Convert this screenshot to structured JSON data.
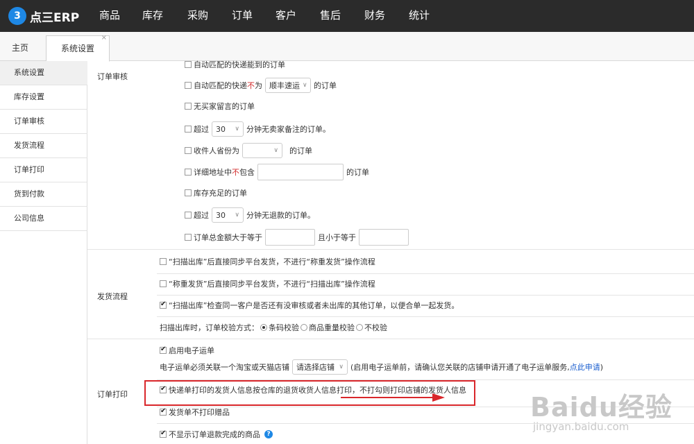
{
  "app": {
    "logo_mark": "3",
    "logo_text": "点三ERP",
    "nav": [
      "商品",
      "库存",
      "采购",
      "订单",
      "客户",
      "售后",
      "财务",
      "统计"
    ]
  },
  "tabs": {
    "home": "主页",
    "settings": "系统设置",
    "close": "×"
  },
  "sidebar": {
    "items": [
      "系统设置",
      "库存设置",
      "订单审核",
      "发货流程",
      "订单打印",
      "货到付款",
      "公司信息"
    ],
    "active": "系统设置"
  },
  "order_review": {
    "label": "订单审核",
    "r1": "自动匹配的快递能到的订单",
    "r2_a": "自动匹配的快递",
    "r2_red": "不",
    "r2_b": "为",
    "r2_select": "顺丰速运",
    "r2_c": "的订单",
    "r3": "无买家留言的订单",
    "r4_a": "超过",
    "r4_select": "30",
    "r4_b": "分钟无卖家备注的订单。",
    "r5_a": "收件人省份为",
    "r5_select": "",
    "r5_b": "的订单",
    "r6_a": "详细地址中",
    "r6_red": "不",
    "r6_b": "包含",
    "r6_c": "的订单",
    "r7": "库存充足的订单",
    "r8_a": "超过",
    "r8_select": "30",
    "r8_b": "分钟无退款的订单。",
    "r9_a": "订单总金额大于等于",
    "r9_b": "且小于等于"
  },
  "shipping": {
    "label": "发货流程",
    "r1": "“扫描出库”后直接同步平台发货，不进行“称重发货”操作流程",
    "r2": "“称重发货”后直接同步平台发货，不进行“扫描出库”操作流程",
    "r3": "“扫描出库”检查同一客户是否还有没审核或者未出库的其他订单，以便合单一起发货。",
    "r4_label": "扫描出库时，订单校验方式：",
    "r4_options": [
      "条码校验",
      "商品重量校验",
      "不校验"
    ],
    "r4_selected": "条码校验"
  },
  "printing": {
    "label": "订单打印",
    "r1": "启用电子运单",
    "r2_a": "电子运单必须关联一个淘宝或天猫店铺",
    "r2_select": "请选择店铺",
    "r2_b": "(启用电子运单前，请确认您关联的店铺申请开通了电子运单服务,",
    "r2_link": "点此申请",
    "r2_c": ")",
    "r3": "快递单打印的发货人信息按仓库的退货收货人信息打印，不打勾则打印店铺的发货人信息",
    "r4": "发货单不打印赠品",
    "r5": "不显示订单退款完成的商品",
    "help_icon": "?"
  },
  "watermark": {
    "brand": "Baidu经验",
    "url": "jingyan.baidu.com"
  },
  "colors": {
    "nav_bg": "#2b2b2b",
    "highlight": "#d9262a",
    "link": "#1a5ecf",
    "accent": "#1e88e5"
  }
}
